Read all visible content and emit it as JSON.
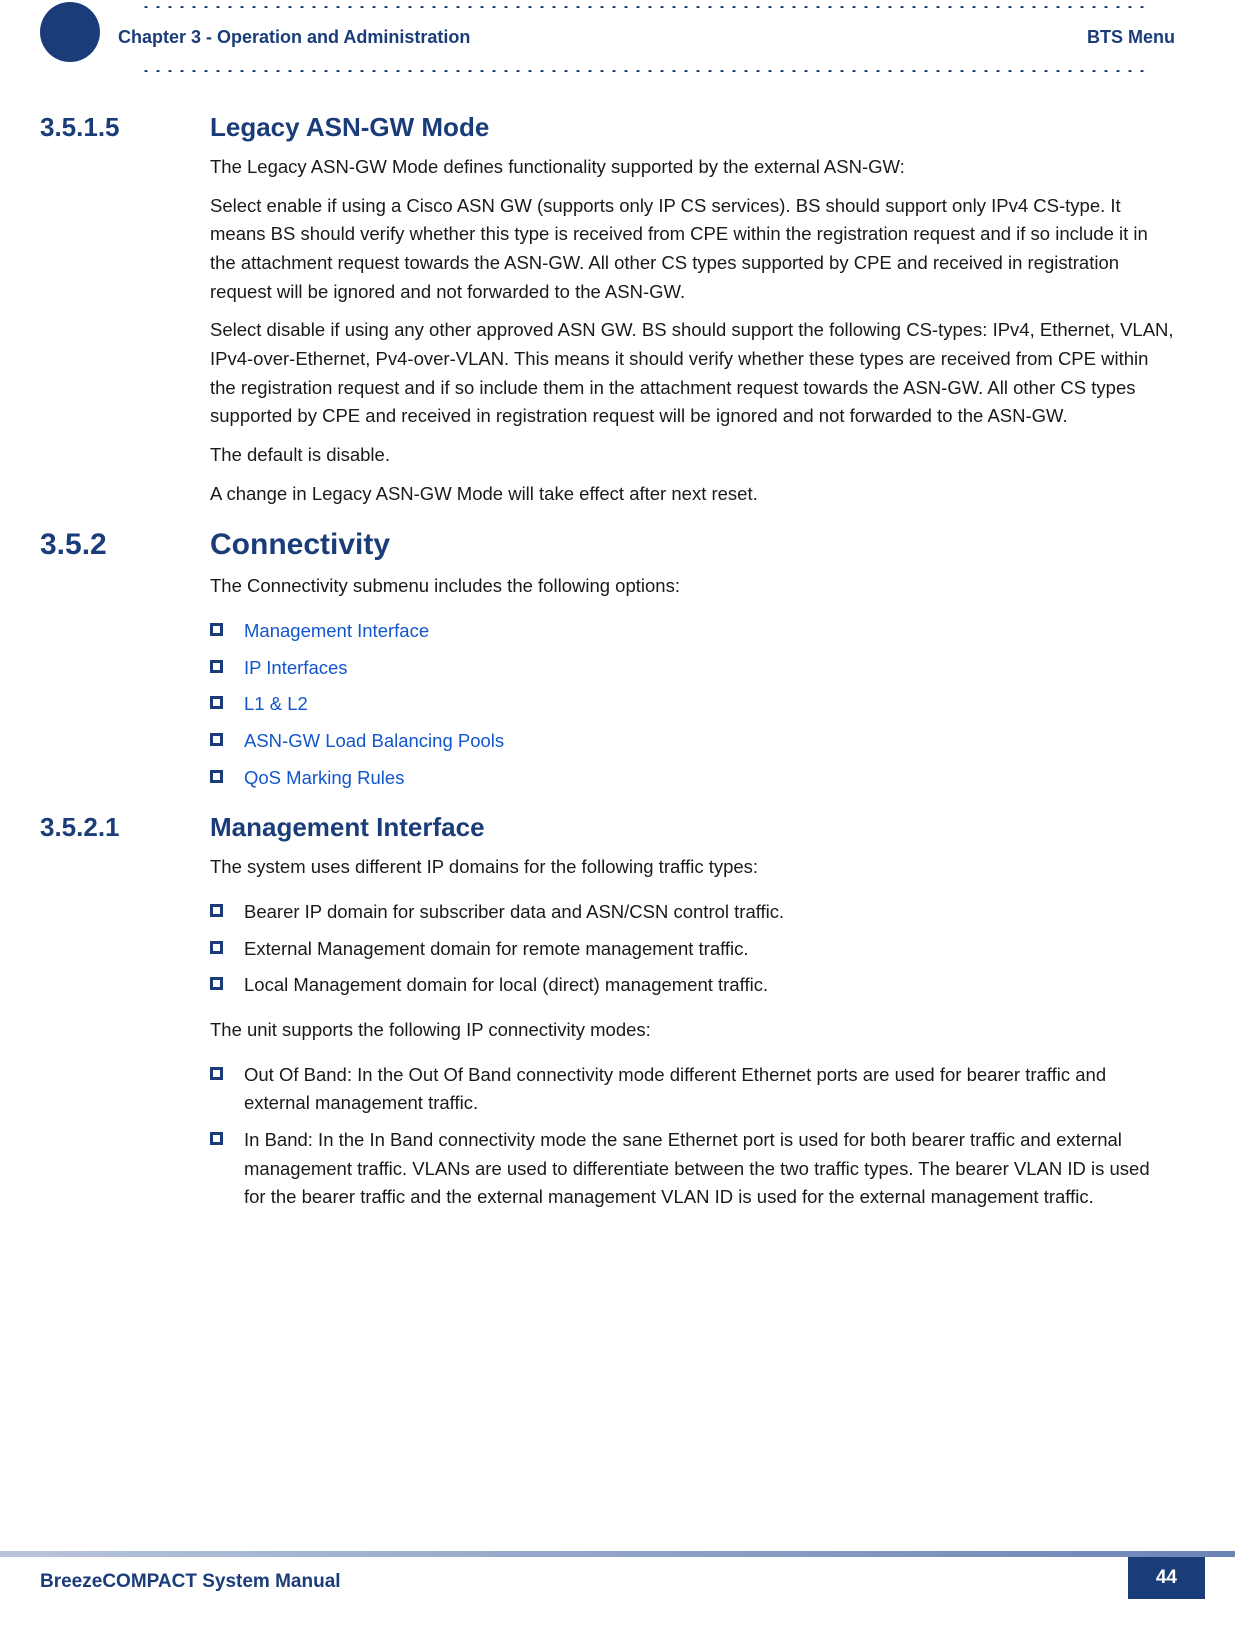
{
  "header": {
    "chapter": "Chapter 3 - Operation and Administration",
    "menu": "BTS Menu"
  },
  "sections": {
    "s1": {
      "num": "3.5.1.5",
      "title": "Legacy ASN-GW Mode",
      "p1": "The Legacy ASN-GW Mode defines functionality supported by the external ASN-GW:",
      "p2": "Select enable if using a Cisco ASN GW (supports only IP CS services). BS should support only IPv4 CS-type. It means BS should verify whether this type is received from CPE within the registration request and if so include it in the attachment request towards the ASN-GW. All other CS types supported by CPE and received in registration request will be ignored and not forwarded to the ASN-GW.",
      "p3": "Select disable if using any other approved ASN GW. BS should support the following CS-types: IPv4, Ethernet, VLAN, IPv4-over-Ethernet, Pv4-over-VLAN. This means it should verify whether these types are received from CPE within the registration request and if so include them in the attachment request towards the ASN-GW. All other CS types supported by CPE and received in registration request will be ignored and not forwarded to the ASN-GW.",
      "p4": "The default is disable.",
      "p5": "A change in Legacy ASN-GW Mode will take effect after next reset."
    },
    "s2": {
      "num": "3.5.2",
      "title": "Connectivity",
      "intro": "The Connectivity submenu includes the following options:",
      "links": {
        "a": "Management Interface",
        "b": "IP Interfaces",
        "c": "L1 & L2",
        "d": "ASN-GW Load Balancing Pools",
        "e": "QoS Marking Rules"
      }
    },
    "s3": {
      "num": "3.5.2.1",
      "title": "Management Interface",
      "p1": "The system uses different IP domains for the following traffic types:",
      "bullets1": {
        "a": "Bearer IP domain for subscriber data and ASN/CSN control traffic.",
        "b": "External Management domain for remote management traffic.",
        "c": "Local Management domain for local (direct) management traffic."
      },
      "p2": "The unit supports the following IP connectivity modes:",
      "bullets2": {
        "a": "Out Of Band: In the Out Of Band connectivity mode different Ethernet ports are used for bearer traffic and external management traffic.",
        "b": "In Band: In the In Band connectivity mode the sane Ethernet port is used for both bearer traffic and external management traffic. VLANs are used to differentiate between the two traffic types. The bearer VLAN ID is used for the bearer traffic and the external management VLAN ID is used for the external management traffic."
      }
    }
  },
  "footer": {
    "title": "BreezeCOMPACT System Manual",
    "page": "44"
  }
}
